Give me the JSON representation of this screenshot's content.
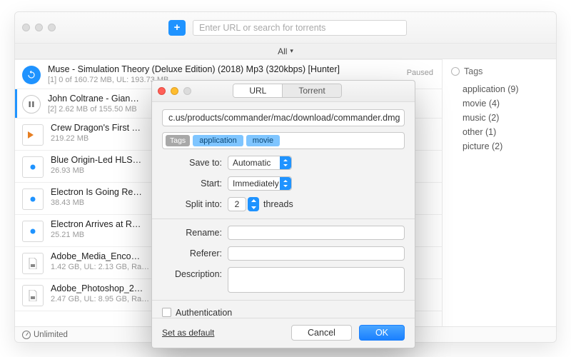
{
  "window": {
    "search_placeholder": "Enter URL or search for torrents",
    "filter_label": "All",
    "status_label": "Unlimited"
  },
  "items": [
    {
      "title": "Muse - Simulation Theory (Deluxe Edition) (2018) Mp3 (320kbps) [Hunter]",
      "sub": "[1] 0 of 160.72 MB, UL: 193.73 MB",
      "status": "Paused",
      "icon": "refresh"
    },
    {
      "title": "John Coltrane - Gian…",
      "sub": "[2] 2.62 MB of 155.50 MB",
      "status": "",
      "icon": "pause"
    },
    {
      "title": "Crew Dragon's First …",
      "sub": "219.22 MB",
      "status": "",
      "icon": "video"
    },
    {
      "title": "Blue Origin-Led HLS…",
      "sub": "26.93 MB",
      "status": "",
      "icon": "file-blue"
    },
    {
      "title": "Electron Is Going Re…",
      "sub": "38.43 MB",
      "status": "",
      "icon": "file-blue"
    },
    {
      "title": "Electron Arrives at R…",
      "sub": "25.21 MB",
      "status": "",
      "icon": "file-blue"
    },
    {
      "title": "Adobe_Media_Enco…",
      "sub": "1.42 GB, UL: 2.13 GB, Ra…",
      "status": "",
      "icon": "doc"
    },
    {
      "title": "Adobe_Photoshop_2…",
      "sub": "2.47 GB, UL: 8.95 GB, Ra…",
      "status": "",
      "icon": "doc"
    }
  ],
  "sidebar": {
    "heading": "Tags",
    "tags": [
      "application (9)",
      "movie (4)",
      "music (2)",
      "other (1)",
      "picture (2)"
    ]
  },
  "sheet": {
    "tab_url": "URL",
    "tab_torrent": "Torrent",
    "url_value": "c.us/products/commander/mac/download/commander.dmg",
    "tags_label": "Tags",
    "chips": [
      "application",
      "movie"
    ],
    "save_to_label": "Save to:",
    "save_to_value": "Automatic",
    "start_label": "Start:",
    "start_value": "Immediately",
    "split_label": "Split into:",
    "split_value": "2",
    "split_suffix": "threads",
    "rename_label": "Rename:",
    "referer_label": "Referer:",
    "description_label": "Description:",
    "auth_label": "Authentication",
    "set_default": "Set as default",
    "cancel": "Cancel",
    "ok": "OK"
  }
}
